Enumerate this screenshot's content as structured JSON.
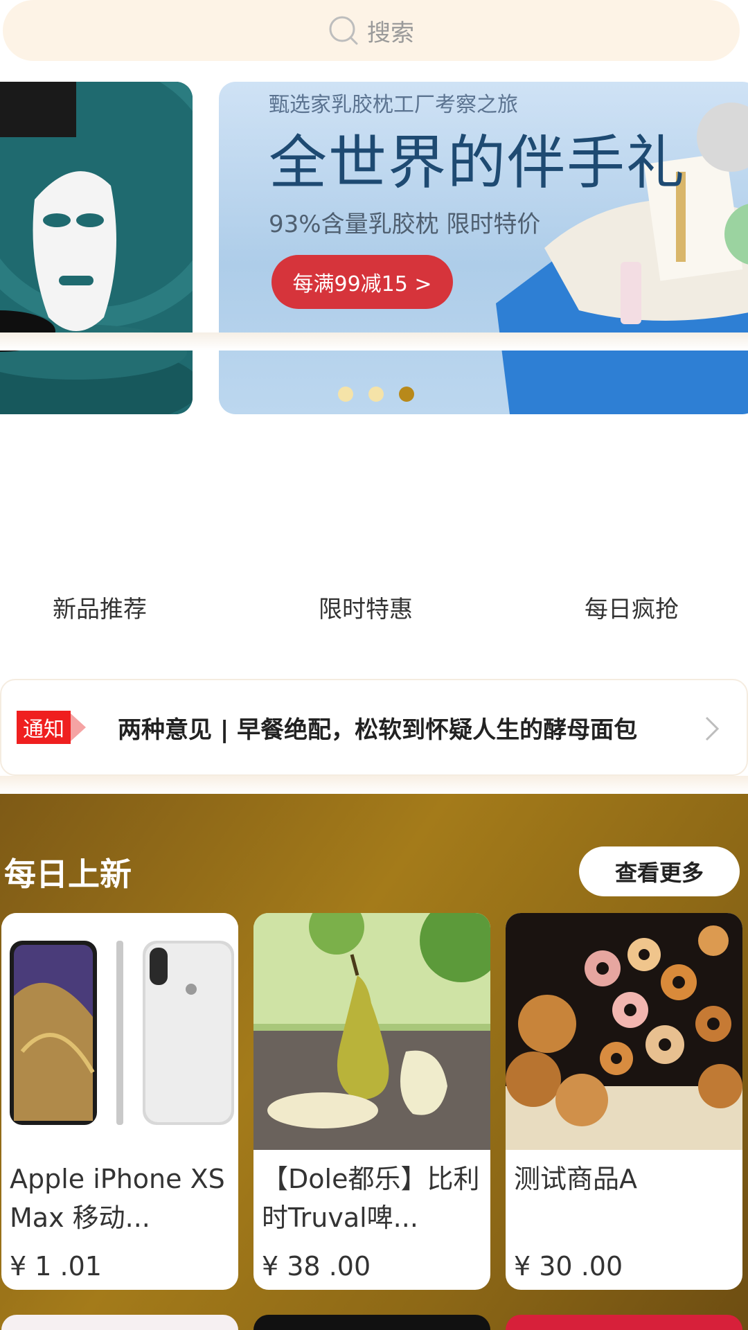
{
  "search": {
    "placeholder": "搜索"
  },
  "banner": {
    "subtitle": "甄选家乳胶枕工厂考察之旅",
    "title": "全世界的伴手礼",
    "description": "93%含量乳胶枕 限时特价",
    "button_label": "每满99减15 >",
    "slide_count": 3,
    "active_slide": 3
  },
  "quick_nav": {
    "items": [
      {
        "label": "新品推荐"
      },
      {
        "label": "限时特惠"
      },
      {
        "label": "每日疯抢"
      }
    ]
  },
  "notice": {
    "tag": "通知",
    "text": "两种意见 | 早餐绝配，松软到怀疑人生的酵母面包"
  },
  "daily_new": {
    "title": "每日上新",
    "more_label": "查看更多",
    "products": [
      {
        "name": "Apple iPhone XS Max 移动...",
        "price": "¥ 1 .01",
        "image": "iphone-image"
      },
      {
        "name": "【Dole都乐】比利时Truval啤...",
        "price": "¥ 38 .00",
        "image": "pear-image"
      },
      {
        "name": "测试商品A",
        "price": "¥ 30 .00",
        "image": "biscuits-image"
      }
    ]
  },
  "colors": {
    "search_bg": "#fdf3e6",
    "accent_gold": "#a47b1a",
    "banner_button": "#d6343b",
    "notice_tag": "#ef1f1f"
  }
}
